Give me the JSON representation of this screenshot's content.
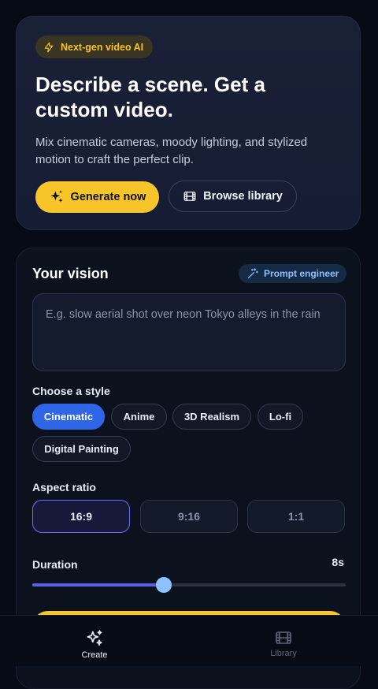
{
  "hero": {
    "badge": "Next-gen video AI",
    "title": "Describe a scene. Get a custom video.",
    "subtitle": "Mix cinematic cameras, moody lighting, and stylized motion to craft the perfect clip.",
    "primary_button": "Generate now",
    "secondary_button": "Browse library"
  },
  "vision": {
    "title": "Your vision",
    "engineer_label": "Prompt engineer",
    "prompt_placeholder": "E.g. slow aerial shot over neon Tokyo alleys in the rain",
    "style_label": "Choose a style",
    "styles": [
      "Cinematic",
      "Anime",
      "3D Realism",
      "Lo-fi",
      "Digital Painting"
    ],
    "selected_style": "Cinematic",
    "aspect_label": "Aspect ratio",
    "aspects": [
      "16:9",
      "9:16",
      "1:1"
    ],
    "selected_aspect": "16:9",
    "duration_label": "Duration",
    "duration_value": "8s",
    "duration_fraction": 0.42
  },
  "nav": {
    "create": "Create",
    "library": "Library"
  },
  "colors": {
    "accent_yellow": "#f7c42a",
    "accent_blue": "#2f66e8",
    "slider_fill": "#5b5fe6",
    "thumb": "#8ec1ff"
  },
  "icons": {
    "badge": "lightning-icon",
    "generate": "sparkles-icon",
    "browse": "film-icon",
    "engineer": "magic-wand-icon",
    "create": "sparkles-icon",
    "library": "film-icon"
  }
}
